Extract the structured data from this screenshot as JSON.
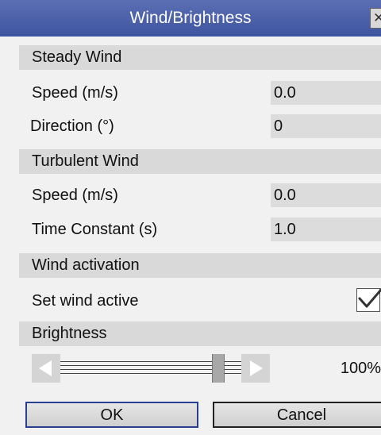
{
  "window": {
    "title": "Wind/Brightness",
    "close_icon": "close-icon"
  },
  "steady_wind": {
    "header": "Steady Wind",
    "speed_label": "Speed (m/s)",
    "speed_value": "0.0",
    "direction_label": "Direction (°)",
    "direction_value": "0"
  },
  "turbulent_wind": {
    "header": "Turbulent Wind",
    "speed_label": "Speed (m/s)",
    "speed_value": "0.0",
    "time_constant_label": "Time Constant (s)",
    "time_constant_value": "1.0"
  },
  "wind_activation": {
    "header": "Wind activation",
    "active_label": "Set wind active",
    "active": true
  },
  "brightness": {
    "header": "Brightness",
    "value_text": "100%",
    "level": 0.9
  },
  "buttons": {
    "ok": "OK",
    "cancel": "Cancel"
  },
  "colors": {
    "titlebar": "#3e54a0",
    "header_bg": "#d9d9d9",
    "field_bg": "#dcdcdc",
    "focus_border": "#2a3f8f"
  }
}
